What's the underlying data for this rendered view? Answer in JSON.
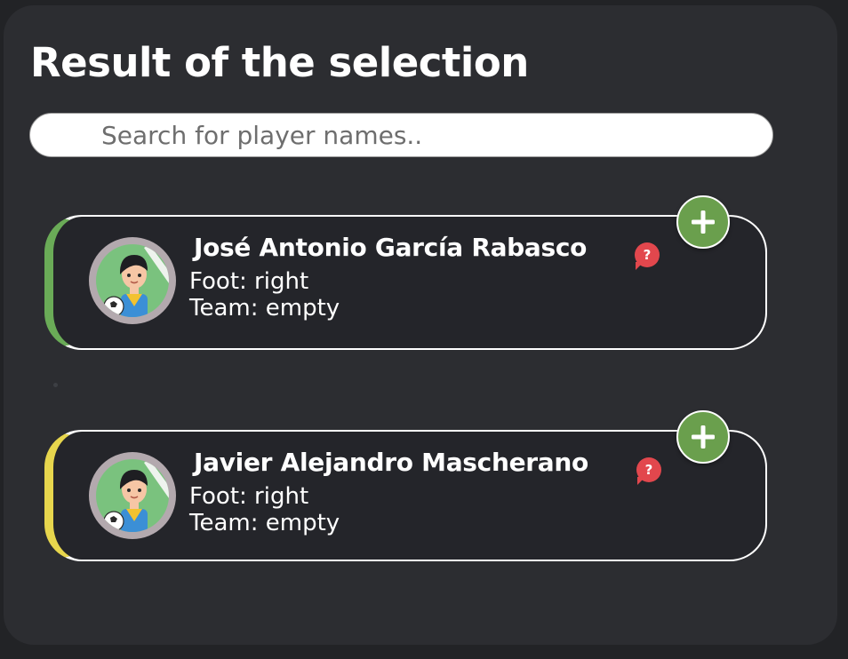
{
  "panel": {
    "title": "Result of the selection"
  },
  "search": {
    "placeholder": "Search for player names..",
    "value": ""
  },
  "players": [
    {
      "name": "José Antonio García Rabasco",
      "foot": "Foot: right",
      "team": "Team: empty",
      "accent_color": "#6aab57",
      "avatar_icon": "player-avatar-icon",
      "help_icon": "help-question-icon",
      "help_glyph": "?",
      "add_icon": "plus-icon"
    },
    {
      "name": "Javier Alejandro Mascherano",
      "foot": "Foot: right",
      "team": "Team: empty",
      "accent_color": "#e7d64d",
      "avatar_icon": "player-avatar-icon",
      "help_icon": "help-question-icon",
      "help_glyph": "?",
      "add_icon": "plus-icon"
    }
  ],
  "colors": {
    "background": "#222326",
    "panel": "#2c2d31",
    "card": "#24252a",
    "add_button": "#6a9f4d",
    "help_badge": "#e2474d"
  }
}
